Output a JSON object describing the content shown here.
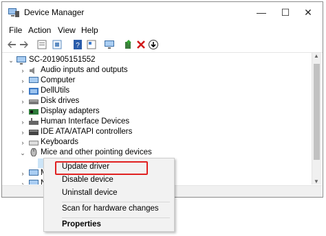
{
  "window": {
    "title": "Device Manager"
  },
  "menu": [
    "File",
    "Action",
    "View",
    "Help"
  ],
  "toolbar_icons": [
    "back-icon",
    "forward-icon",
    "properties-icon",
    "update-icon",
    "help-icon",
    "view-icon",
    "monitor-icon",
    "add-driver-icon",
    "uninstall-icon",
    "download-icon"
  ],
  "tree": {
    "root": "SC-201905151552",
    "categories": [
      {
        "label": "Audio inputs and outputs",
        "icon": "speaker-icon"
      },
      {
        "label": "Computer",
        "icon": "computer-icon"
      },
      {
        "label": "DellUtils",
        "icon": "folder-icon"
      },
      {
        "label": "Disk drives",
        "icon": "disk-drive-icon"
      },
      {
        "label": "Display adapters",
        "icon": "display-adapter-icon"
      },
      {
        "label": "Human Interface Devices",
        "icon": "hid-icon"
      },
      {
        "label": "IDE ATA/ATAPI controllers",
        "icon": "ide-controller-icon"
      },
      {
        "label": "Keyboards",
        "icon": "keyboard-icon"
      },
      {
        "label": "Mice and other pointing devices",
        "icon": "mouse-icon"
      }
    ],
    "partial_rows": [
      "M",
      "N"
    ]
  },
  "context_menu": {
    "items": [
      "Update driver",
      "Disable device",
      "Uninstall device",
      "Scan for hardware changes",
      "Properties"
    ],
    "highlighted": "Update driver"
  },
  "colors": {
    "highlight_border": "#e02020",
    "accent_blue": "#1e6fd9"
  }
}
